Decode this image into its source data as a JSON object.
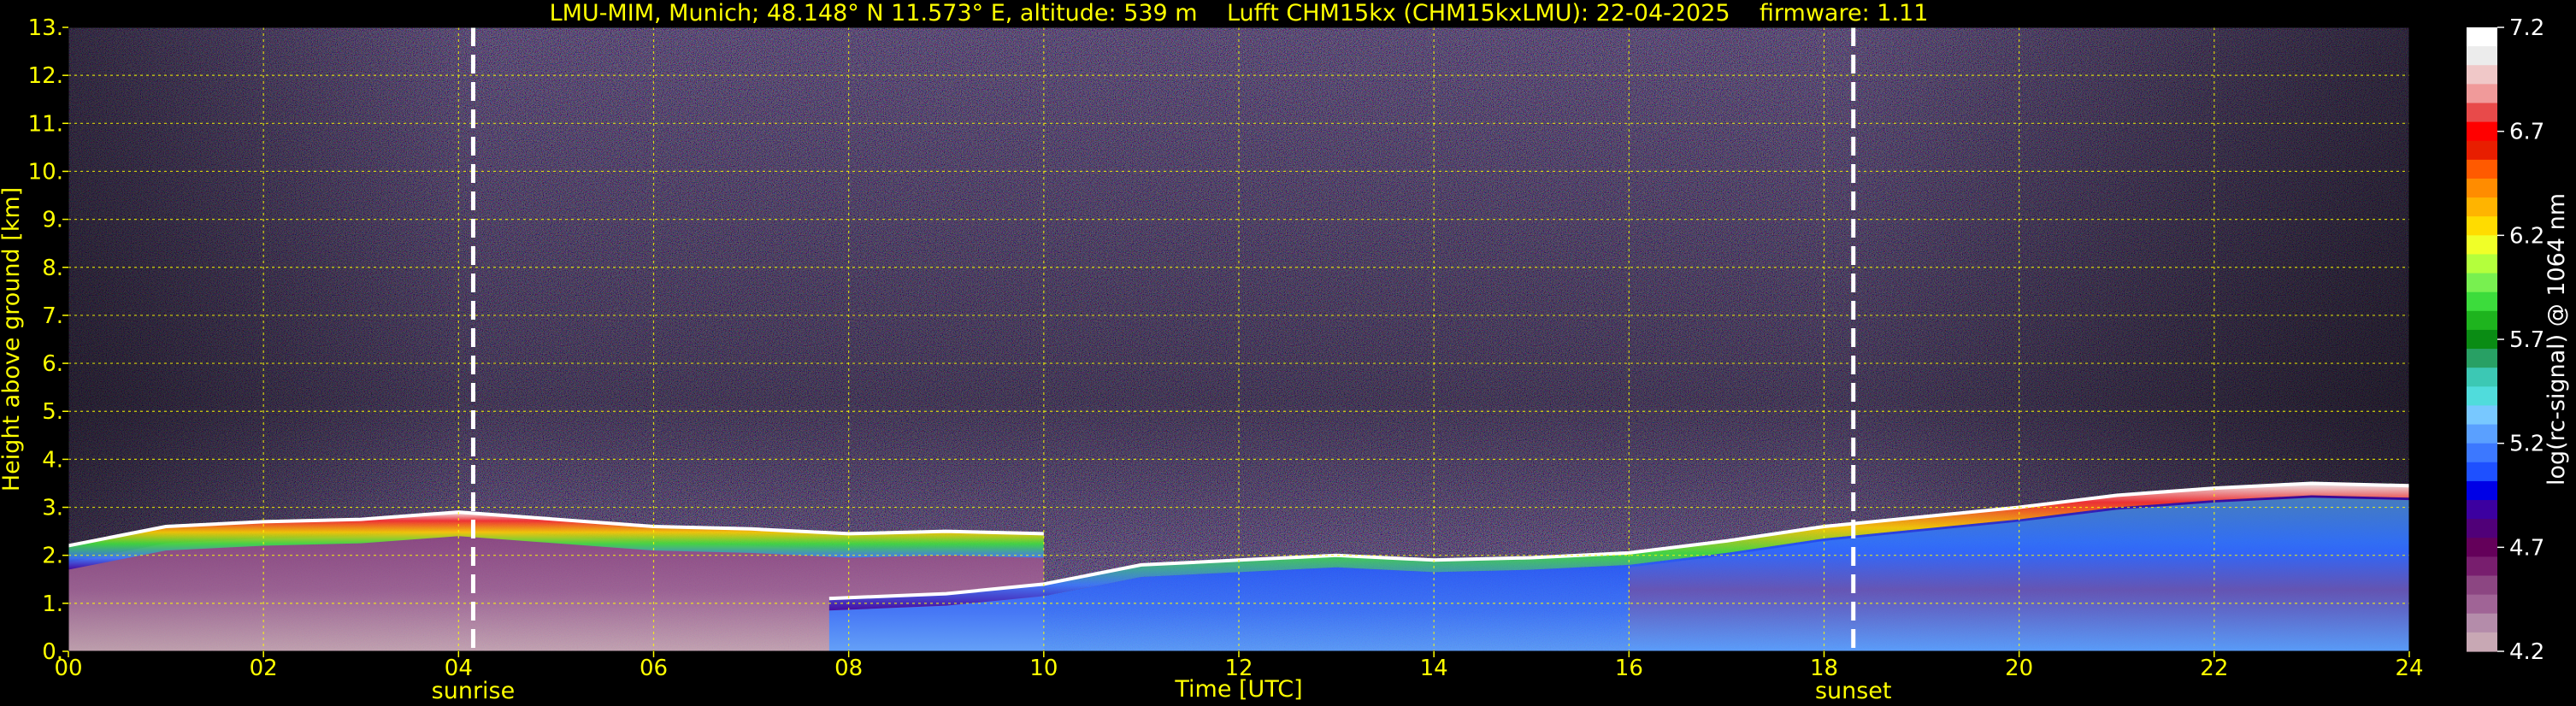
{
  "chart_data": {
    "type": "heatmap",
    "title": "LMU-MIM, Munich; 48.148° N 11.573° E, altitude: 539 m    Lufft CHM15kx (CHM15kxLMU): 22-04-2025    firmware: 1.11",
    "xlabel": "Time [UTC]",
    "ylabel": "Height above ground [km]",
    "xlim": [
      0,
      24
    ],
    "ylim": [
      0,
      13
    ],
    "x_ticks": [
      "00",
      "02",
      "04",
      "06",
      "08",
      "10",
      "12",
      "14",
      "16",
      "18",
      "20",
      "22",
      "24"
    ],
    "y_ticks": [
      "0.",
      "1.",
      "2.",
      "3.",
      "4.",
      "5.",
      "6.",
      "7.",
      "8.",
      "9.",
      "10.",
      "11.",
      "12.",
      "13."
    ],
    "grid": true,
    "grid_color": "#ffff00",
    "markers": [
      {
        "label": "sunrise",
        "x": 4.15
      },
      {
        "label": "sunset",
        "x": 18.3
      }
    ],
    "colorbar": {
      "label": "log(rc-signal) @ 1064 nm",
      "range": [
        4.2,
        7.2
      ],
      "ticks": [
        "7.2",
        "6.7",
        "6.2",
        "5.7",
        "5.2",
        "4.7",
        "4.2"
      ],
      "colors": [
        "#ffffff",
        "#ececec",
        "#f0c8c8",
        "#f09a9a",
        "#e84a4a",
        "#ff0000",
        "#e81e00",
        "#ff5a00",
        "#ff8c00",
        "#ffb400",
        "#ffdc00",
        "#f0ff28",
        "#b4ff3c",
        "#78f050",
        "#3cdc3c",
        "#1eb41e",
        "#0a8c14",
        "#28a064",
        "#3cc8b4",
        "#50dcdc",
        "#78c8ff",
        "#5aa0ff",
        "#3c78ff",
        "#1e50ff",
        "#0000e6",
        "#3c00a0",
        "#500078",
        "#64005a",
        "#781e6e",
        "#8c4682",
        "#a06496",
        "#b48caa",
        "#c8a8b4"
      ]
    },
    "layers": [
      {
        "name": "aerosol-boundary-top",
        "points": [
          [
            0,
            2.2
          ],
          [
            1,
            2.6
          ],
          [
            2,
            2.7
          ],
          [
            3,
            2.75
          ],
          [
            4,
            2.9
          ],
          [
            5,
            2.75
          ],
          [
            6,
            2.6
          ],
          [
            7,
            2.55
          ],
          [
            8,
            2.45
          ],
          [
            9,
            2.5
          ],
          [
            10,
            2.45
          ]
        ]
      },
      {
        "name": "cloud-base-day",
        "points": [
          [
            7.8,
            1.1
          ],
          [
            9,
            1.2
          ],
          [
            10,
            1.4
          ],
          [
            11,
            1.8
          ],
          [
            12,
            1.9
          ],
          [
            13,
            2.0
          ],
          [
            14,
            1.9
          ],
          [
            15,
            1.95
          ],
          [
            16,
            2.05
          ],
          [
            17,
            2.3
          ],
          [
            18,
            2.6
          ],
          [
            19,
            2.8
          ],
          [
            20,
            3.0
          ],
          [
            21,
            3.25
          ],
          [
            22,
            3.4
          ],
          [
            23,
            3.5
          ],
          [
            24,
            3.45
          ]
        ]
      }
    ]
  },
  "colors": {
    "text": "#ffff00",
    "marker": "#ffffff",
    "background": "#000000"
  }
}
